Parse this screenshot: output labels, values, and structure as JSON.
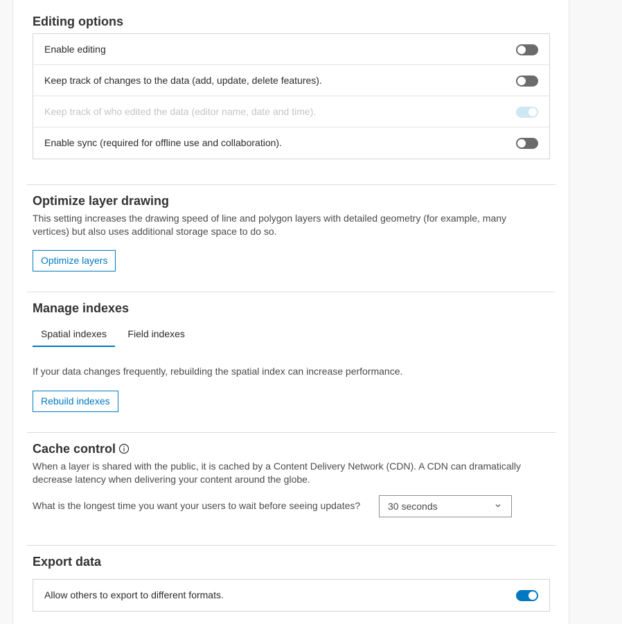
{
  "editing": {
    "title": "Editing options",
    "rows": [
      {
        "label": "Enable editing",
        "state": "off"
      },
      {
        "label": "Keep track of changes to the data (add, update, delete features).",
        "state": "off"
      },
      {
        "label": "Keep track of who edited the data (editor name, date and time).",
        "state": "disabled-on"
      },
      {
        "label": "Enable sync (required for offline use and collaboration).",
        "state": "off"
      }
    ]
  },
  "optimize": {
    "title": "Optimize layer drawing",
    "description": "This setting increases the drawing speed of line and polygon layers with detailed geometry (for example, many vertices) but also uses additional storage space to do so.",
    "button_label": "Optimize layers"
  },
  "indexes": {
    "title": "Manage indexes",
    "tabs": [
      "Spatial indexes",
      "Field indexes"
    ],
    "active_tab": "Spatial indexes",
    "description": "If your data changes frequently, rebuilding the spatial index can increase performance.",
    "button_label": "Rebuild indexes"
  },
  "cache": {
    "title": "Cache control",
    "info_icon": "info-icon",
    "description": "When a layer is shared with the public, it is cached by a Content Delivery Network (CDN). A CDN can dramatically decrease latency when delivering your content around the globe.",
    "question": "What is the longest time you want your users to wait before seeing updates?",
    "select_value": "30 seconds"
  },
  "export": {
    "title": "Export data",
    "rows": [
      {
        "label": "Allow others to export to different formats.",
        "state": "on"
      }
    ]
  },
  "colors": {
    "accent": "#0079c1",
    "toggle_off": "#6b6b6b",
    "toggle_disabled": "#cfe6f3"
  }
}
